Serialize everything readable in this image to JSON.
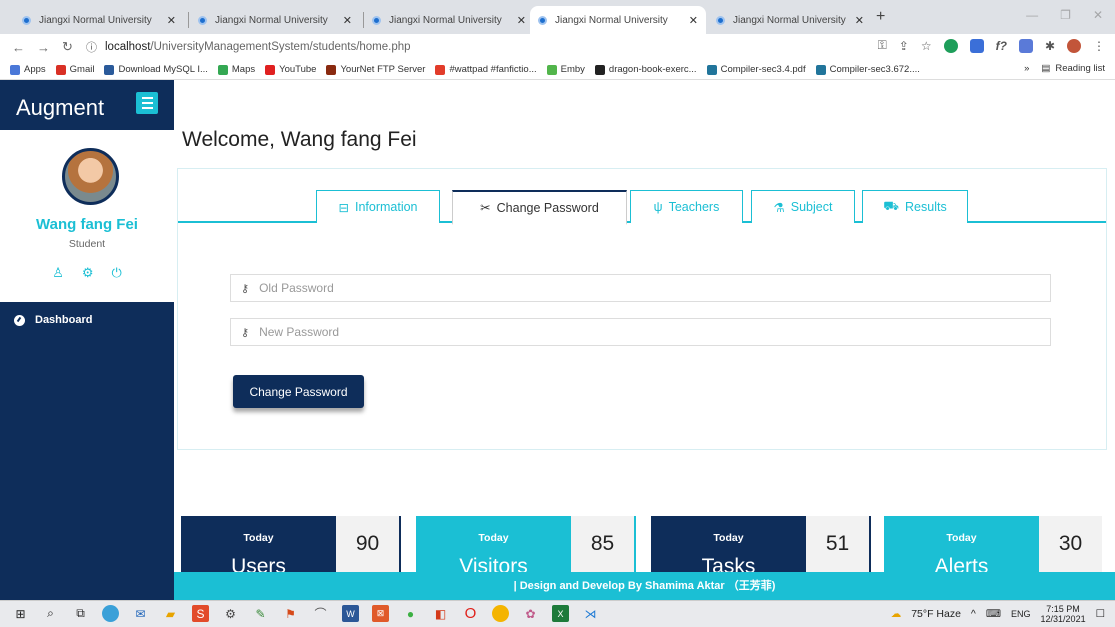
{
  "browser": {
    "tabs": [
      {
        "title": "Jiangxi Normal University",
        "active": false
      },
      {
        "title": "Jiangxi Normal University",
        "active": false
      },
      {
        "title": "Jiangxi Normal University",
        "active": false
      },
      {
        "title": "Jiangxi Normal University",
        "active": true
      },
      {
        "title": "Jiangxi Normal University",
        "active": false
      }
    ],
    "new_tab": "+",
    "url_host": "localhost",
    "url_path": "/UniversityManagementSystem/students/home.php",
    "bookmarks": [
      {
        "label": "Apps",
        "color": "#4a78d8"
      },
      {
        "label": "Gmail",
        "color": "#d93025"
      },
      {
        "label": "Download MySQL I...",
        "color": "#2a5a9a"
      },
      {
        "label": "Maps",
        "color": "#34a853"
      },
      {
        "label": "YouTube",
        "color": "#e02020"
      },
      {
        "label": "YourNet FTP Server",
        "color": "#8a2a10"
      },
      {
        "label": "#wattpad #fanfictio...",
        "color": "#e23c2a"
      },
      {
        "label": "Emby",
        "color": "#52b54b"
      },
      {
        "label": "dragon-book-exerc...",
        "color": "#222222"
      },
      {
        "label": "Compiler-sec3.4.pdf",
        "color": "#21759b"
      },
      {
        "label": "Compiler-sec3.672....",
        "color": "#21759b"
      }
    ],
    "reading_list": "Reading list"
  },
  "sidebar": {
    "brand": "Augment",
    "user_name": "Wang fang Fei",
    "user_role": "Student",
    "items": [
      {
        "label": "Dashboard"
      }
    ]
  },
  "main": {
    "welcome": "Welcome, Wang fang Fei",
    "tabs": [
      {
        "label": "Information",
        "icon": "suitcase-icon"
      },
      {
        "label": "Change Password",
        "icon": "scissors-icon"
      },
      {
        "label": "Teachers",
        "icon": "utensils-icon"
      },
      {
        "label": "Subject",
        "icon": "flask-icon"
      },
      {
        "label": "Results",
        "icon": "truck-icon"
      }
    ],
    "old_password_placeholder": "Old Password",
    "new_password_placeholder": "New Password",
    "submit_label": "Change Password"
  },
  "stats": [
    {
      "today": "Today",
      "label": "Users",
      "value": "90"
    },
    {
      "today": "Today",
      "label": "Visitors",
      "value": "85"
    },
    {
      "today": "Today",
      "label": "Tasks",
      "value": "51"
    },
    {
      "today": "Today",
      "label": "Alerts",
      "value": "30"
    }
  ],
  "footer": "| Design and Develop By Shamima Aktar （王芳菲)",
  "taskbar": {
    "weather": "75°F Haze",
    "lang": "ENG",
    "time": "7:15 PM",
    "date": "12/31/2021"
  },
  "colors": {
    "navy": "#0e2d5a",
    "cyan": "#1bbfd4"
  }
}
